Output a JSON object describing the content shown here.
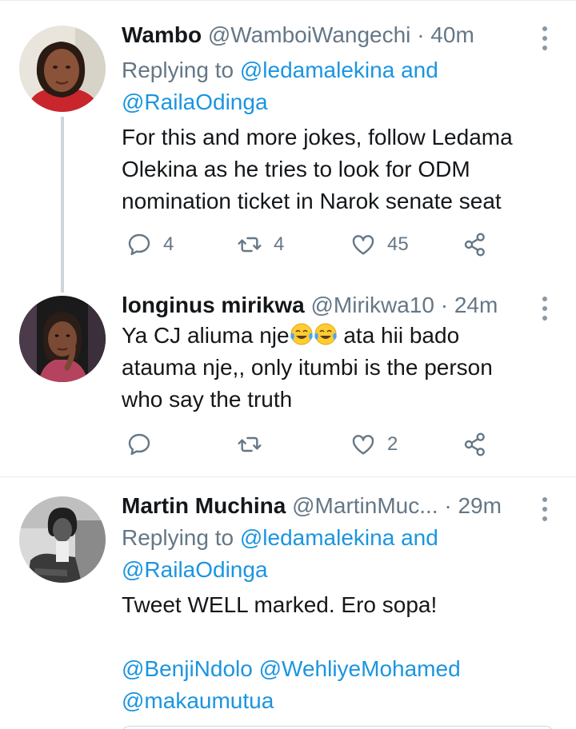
{
  "tweets": [
    {
      "display_name": "Wambo",
      "handle": "@WamboiWangechi",
      "dot": "·",
      "time": "40m",
      "replying_prefix": "Replying to ",
      "replying_user1": "@ledamalekina",
      "replying_and": " and",
      "replying_user2": "@RailaOdinga",
      "text_lines": [
        "For this and more jokes, follow Ledama",
        "Olekina as he tries to look for ODM",
        "nomination ticket in Narok senate seat"
      ],
      "reply_count": "4",
      "retweet_count": "4",
      "like_count": "45"
    },
    {
      "display_name": "longinus mirikwa",
      "handle": "@Mirikwa10",
      "dot": "·",
      "time": "24m",
      "text_line1_prefix": "Ya CJ aliuma nje",
      "text_line1_suffix": " ata hii bado",
      "text_lines": [
        "atauma nje,, only itumbi is the person",
        "who say the truth"
      ],
      "reply_count": "",
      "retweet_count": "",
      "like_count": "2"
    },
    {
      "display_name": "Martin Muchina",
      "handle": "@MartinMuc...",
      "dot": "·",
      "time": "29m",
      "replying_prefix": "Replying to ",
      "replying_user1": "@ledamalekina",
      "replying_and": " and",
      "replying_user2": "@RailaOdinga",
      "text_lines": [
        "Tweet WELL marked. Ero sopa!"
      ],
      "mentions_line1": "@BenjiNdolo @WehliyeMohamed",
      "mentions_line2": "@makaumutua"
    }
  ],
  "colors": {
    "link": "#1b95e0",
    "secondary": "#657786",
    "thread_line": "#ccd6dd"
  },
  "icons": [
    "reply-icon",
    "retweet-icon",
    "like-icon",
    "share-icon",
    "more-options-icon"
  ]
}
